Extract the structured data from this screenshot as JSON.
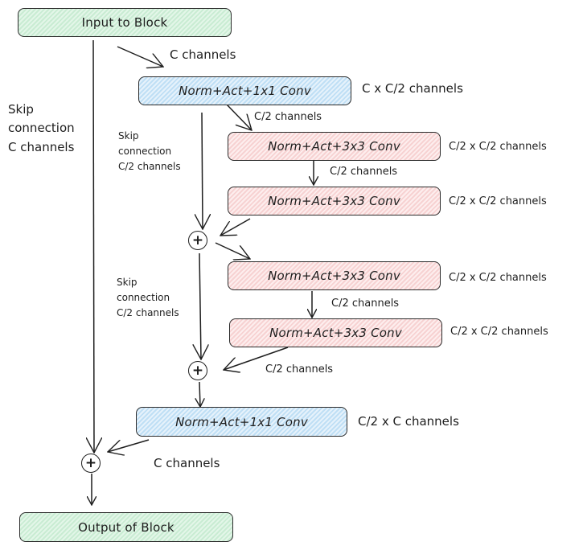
{
  "nodes": {
    "input": "Input to Block",
    "conv1x1_in": "Norm+Act+1x1 Conv",
    "conv3x3_a1": "Norm+Act+3x3 Conv",
    "conv3x3_a2": "Norm+Act+3x3 Conv",
    "conv3x3_b1": "Norm+Act+3x3 Conv",
    "conv3x3_b2": "Norm+Act+3x3 Conv",
    "conv1x1_out": "Norm+Act+1x1 Conv",
    "output": "Output of Block",
    "sum_symbol": "+"
  },
  "labels": {
    "input_edge": "C channels",
    "conv1x1_in_dims": "C x C/2 channels",
    "conv1x1_in_edge": "C/2 channels",
    "conv3x3_a1_dims": "C/2 x C/2 channels",
    "conv3x3_a_mid_edge": "C/2 channels",
    "conv3x3_a2_dims": "C/2 x C/2 channels",
    "conv3x3_b1_dims": "C/2 x C/2 channels",
    "conv3x3_b_mid_edge": "C/2 channels",
    "conv3x3_b2_dims": "C/2 x C/2 channels",
    "conv3x3_b2_edge": "C/2 channels",
    "conv1x1_out_dims": "C/2 x C channels",
    "conv1x1_out_edge": "C channels",
    "skip_outer": "Skip\nconnection\nC channels",
    "skip_inner_1": "Skip\nconnection\nC/2 channels",
    "skip_inner_2": "Skip\nconnection\nC/2 channels"
  },
  "colors": {
    "io_fill": "#d3f0dc",
    "conv1x1_fill": "#cfe6f7",
    "conv3x3_fill": "#f9dede",
    "stroke": "#1e1e1e"
  }
}
